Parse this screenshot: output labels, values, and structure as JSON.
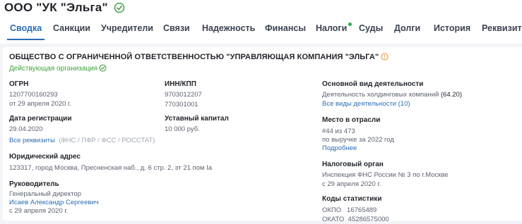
{
  "company": {
    "title": "ООО \"УК \"Эльга\""
  },
  "tabs": [
    {
      "label": "Сводка",
      "active": true
    },
    {
      "label": "Санкции"
    },
    {
      "label": "Учредители"
    },
    {
      "label": "Связи"
    },
    {
      "label": "Надежность"
    },
    {
      "label": "Финансы"
    },
    {
      "label": "Налоги",
      "has_dot": true
    },
    {
      "label": "Суды"
    },
    {
      "label": "Долги"
    },
    {
      "label": "История"
    },
    {
      "label": "Реквизиты"
    }
  ],
  "card": {
    "org_name": "ОБЩЕСТВО С ОГРАНИЧЕННОЙ ОТВЕТСТВЕННОСТЬЮ \"УПРАВЛЯЮЩАЯ КОМПАНИЯ \"ЭЛЬГА\"",
    "status": "Действующая организация",
    "ogrn": {
      "label": "ОГРН",
      "value": "1207700160293",
      "date": "от 29 апреля 2020 г."
    },
    "inn_kpp": {
      "label": "ИНН/КПП",
      "inn": "9703012207",
      "kpp": "770301001"
    },
    "reg_date": {
      "label": "Дата регистрации",
      "value": "29.04.2020"
    },
    "capital": {
      "label": "Уставный капитал",
      "value": "10 000 руб."
    },
    "requisites": {
      "link": "Все реквизиты",
      "note": "(ФНС / ПФР / ФСС / РОССТАТ)"
    },
    "address": {
      "label": "Юридический адрес",
      "value": "123317, город Москва, Пресненская наб., д. 6 стр. 2, эт 21 пом Ia"
    },
    "manager": {
      "label": "Руководитель",
      "position": "Генеральный директор",
      "name": "Исаев Александр Сергеевич",
      "since": "с 29 апреля 2020 г."
    },
    "activity": {
      "label": "Основной вид деятельности",
      "value": "Деятельность холдинговых компаний",
      "code": "(64.20)",
      "link": "Все виды деятельности (10)"
    },
    "industry_rank": {
      "label": "Место в отрасли",
      "rank": "#44 из 473",
      "basis": "по выручке за 2022 год",
      "link": "Подробнее"
    },
    "tax_authority": {
      "label": "Налоговый орган",
      "value": "Инспекция ФНС России № 3 по г.Москве",
      "since": "с 29 апреля 2020 г."
    },
    "stat_codes": {
      "label": "Коды статистики",
      "okpo": "ОКПО   16765489",
      "okato": "ОКАТО  45286575000"
    }
  },
  "colors": {
    "accent": "#2a6db3",
    "status_green": "#3fa33f",
    "dot_green": "#22b14c",
    "warning_orange": "#e8a33d"
  }
}
